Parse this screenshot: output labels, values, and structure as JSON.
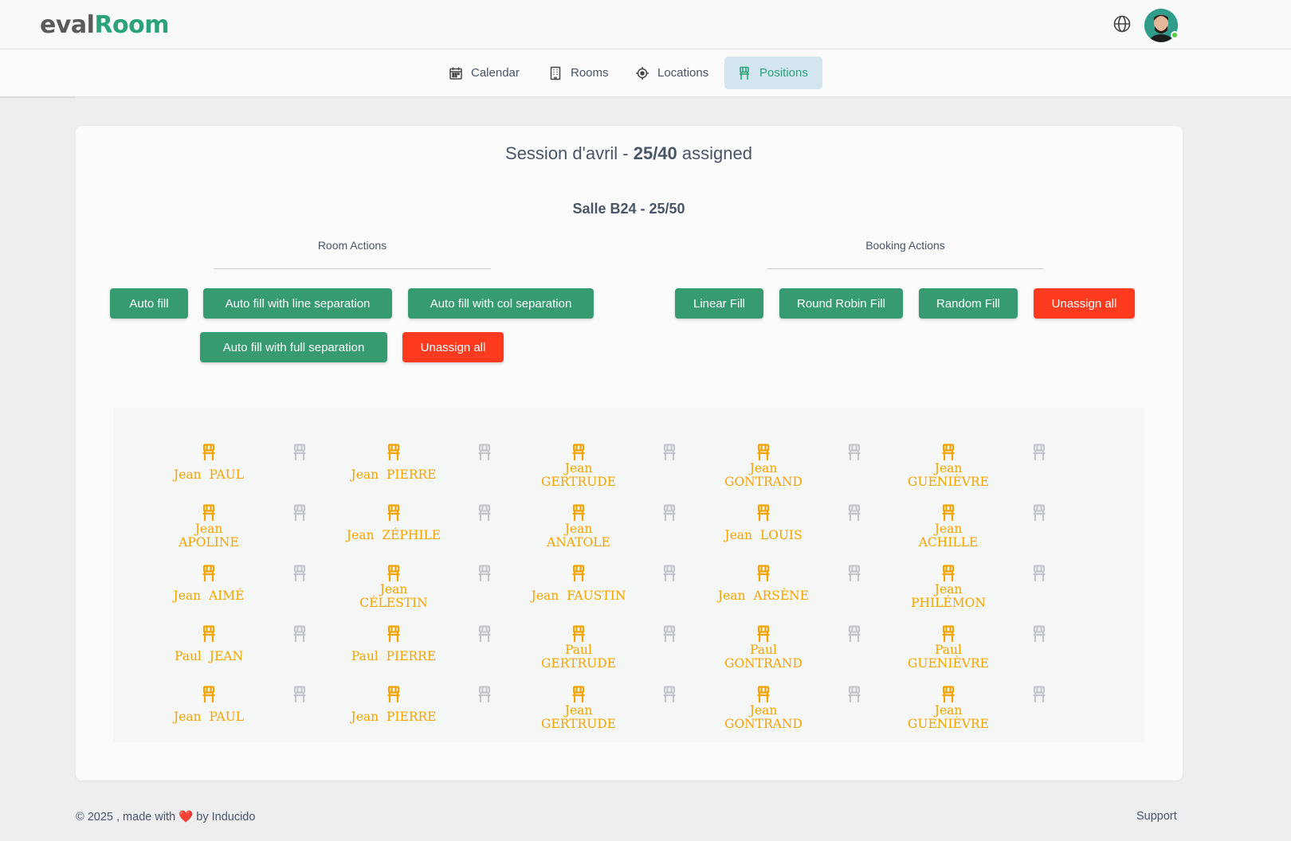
{
  "app": {
    "logo_part1": "eval",
    "logo_part2": "Room"
  },
  "nav": {
    "tabs": [
      {
        "label": "Calendar",
        "icon": "calendar-icon"
      },
      {
        "label": "Rooms",
        "icon": "building-icon"
      },
      {
        "label": "Locations",
        "icon": "target-icon"
      },
      {
        "label": "Positions",
        "icon": "chair-icon",
        "active": true
      }
    ]
  },
  "session": {
    "name": "Session d'avril - ",
    "count": "25/40",
    "suffix": " assigned"
  },
  "room": {
    "title": "Salle B24 - 25/50"
  },
  "room_actions": {
    "label": "Room Actions",
    "auto_fill": "Auto fill",
    "auto_fill_line": "Auto fill with line separation",
    "auto_fill_col": "Auto fill with col separation",
    "auto_fill_full": "Auto fill with full separation",
    "unassign_all": "Unassign all"
  },
  "booking_actions": {
    "label": "Booking Actions",
    "linear_fill": "Linear Fill",
    "round_robin_fill": "Round Robin Fill",
    "random_fill": "Random Fill",
    "unassign_all": "Unassign all"
  },
  "seats": {
    "rows": [
      [
        "Jean  PAUL",
        "",
        "Jean  PIERRE",
        "",
        "Jean\nGERTRUDE",
        "",
        "Jean\nGONTRAND",
        "",
        "Jean\nGUENIÈVRE",
        ""
      ],
      [
        "Jean\nAPOLINE",
        "",
        "Jean  ZÉPHILE",
        "",
        "Jean\nANATOLE",
        "",
        "Jean  LOUIS",
        "",
        "Jean\nACHILLE",
        ""
      ],
      [
        "Jean  AIMÉ",
        "",
        "Jean\nCÉLESTIN",
        "",
        "Jean  FAUSTIN",
        "",
        "Jean  ARSÈNE",
        "",
        "Jean\nPHILÉMON",
        ""
      ],
      [
        "Paul  JEAN",
        "",
        "Paul  PIERRE",
        "",
        "Paul\nGERTRUDE",
        "",
        "Paul\nGONTRAND",
        "",
        "Paul\nGUENIÈVRE",
        ""
      ],
      [
        "Jean  PAUL",
        "",
        "Jean  PIERRE",
        "",
        "Jean\nGERTRUDE",
        "",
        "Jean\nGONTRAND",
        "",
        "Jean\nGUENIÈVRE",
        ""
      ]
    ],
    "assigned_color": "#f5a300",
    "empty_color": "#c3c6cb"
  },
  "footer": {
    "copyright": "© 2025 , made with ",
    "heart": "❤️",
    "by": " by ",
    "brand": "Inducido",
    "support": "Support"
  },
  "colors": {
    "accent_green": "#379b72",
    "danger_red": "#ff3b1f",
    "active_tab_bg": "#d3e5ee"
  }
}
